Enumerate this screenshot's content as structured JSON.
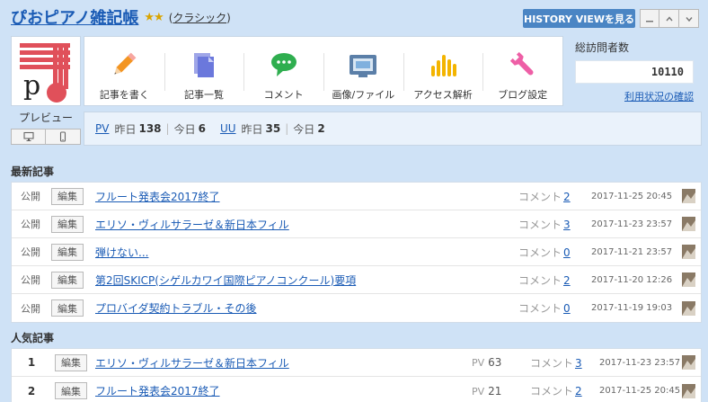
{
  "header": {
    "blog_title": "ぴおピアノ雑記帳",
    "stars": "★★",
    "classic_open": "(",
    "classic": "クラシック",
    "classic_close": ")",
    "history_button": "HISTORY VIEWを見る"
  },
  "sidebar": {
    "preview_label": "プレビュー"
  },
  "menu": {
    "items": [
      {
        "label": "記事を書く",
        "icon": "pencil-icon"
      },
      {
        "label": "記事一覧",
        "icon": "documents-icon"
      },
      {
        "label": "コメント",
        "icon": "speech-bubble-icon"
      },
      {
        "label": "画像/ファイル",
        "icon": "image-folder-icon"
      },
      {
        "label": "アクセス解析",
        "icon": "bar-chart-icon"
      },
      {
        "label": "ブログ設定",
        "icon": "wrench-icon"
      }
    ]
  },
  "visitors": {
    "title": "総訪問者数",
    "count": "10110",
    "link": "利用状況の確認"
  },
  "stats": {
    "pv_label": "PV",
    "yesterday": "昨日",
    "pv_yesterday": "138",
    "today": "今日",
    "pv_today": "6",
    "uu_label": "UU",
    "uu_yesterday": "35",
    "uu_today": "2"
  },
  "latest": {
    "title": "最新記事",
    "status": "公開",
    "edit": "編集",
    "comment_label": "コメント",
    "rows": [
      {
        "title": "フルート発表会2017終了",
        "comments": "2",
        "date": "2017-11-25 20:45"
      },
      {
        "title": "エリソ・ヴィルサラーゼ＆新日本フィル",
        "comments": "3",
        "date": "2017-11-23 23:57"
      },
      {
        "title": "弾けない...",
        "comments": "0",
        "date": "2017-11-21 23:57"
      },
      {
        "title": "第2回SKICP(シゲルカワイ国際ピアノコンクール)要項",
        "comments": "2",
        "date": "2017-11-20 12:26"
      },
      {
        "title": "プロバイダ契約トラブル・その後",
        "comments": "0",
        "date": "2017-11-19 19:03"
      }
    ]
  },
  "popular": {
    "title": "人気記事",
    "edit": "編集",
    "pv_label": "PV",
    "comment_label": "コメント",
    "rows": [
      {
        "rank": "1",
        "title": "エリソ・ヴィルサラーゼ＆新日本フィル",
        "pv": "63",
        "comments": "3",
        "date": "2017-11-23 23:57"
      },
      {
        "rank": "2",
        "title": "フルート発表会2017終了",
        "pv": "21",
        "comments": "2",
        "date": "2017-11-25 20:45"
      }
    ]
  },
  "colors": {
    "background": "#cfe2f6",
    "accent": "#4a85c4",
    "link": "#1a5bb5",
    "avatar_red": "#e0505a"
  }
}
